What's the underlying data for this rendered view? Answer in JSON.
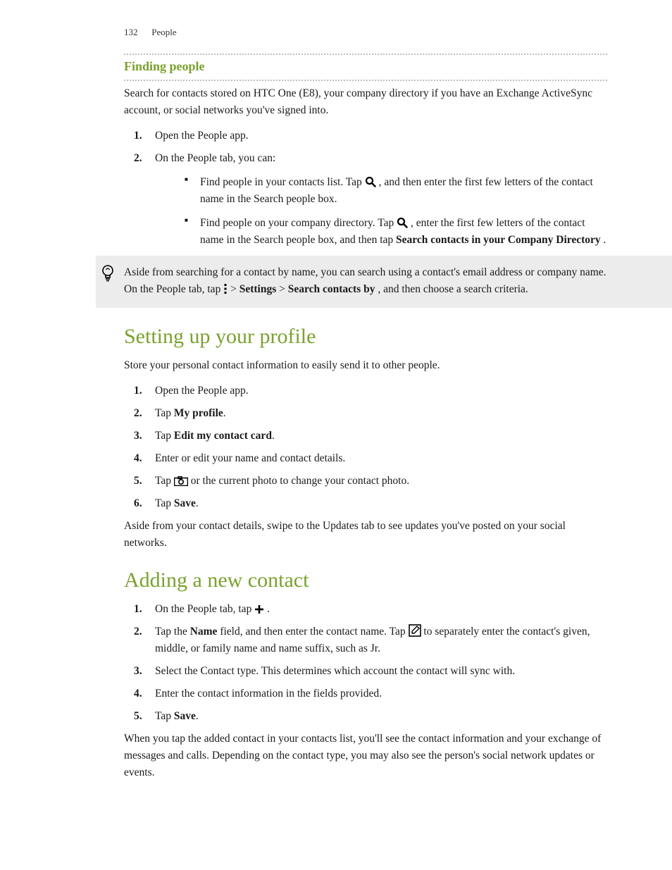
{
  "header": {
    "page_number": "132",
    "section": "People"
  },
  "sec_finding": {
    "title": "Finding people",
    "intro": "Search for contacts stored on HTC One (E8), your company directory if you have an Exchange ActiveSync account, or social networks you've signed into.",
    "step1": "Open the People app.",
    "step2": "On the People tab, you can:",
    "b1a": "Find people in your contacts list. Tap ",
    "b1b": " , and then enter the first few letters of the contact name in the Search people box.",
    "b2a": "Find people on your company directory. Tap ",
    "b2b": " , enter the first few letters of the contact name in the Search people box, and then tap ",
    "b2c": "Search contacts in your Company Directory",
    "b2d": "."
  },
  "tip": {
    "t1": "Aside from searching for a contact by name, you can search using a contact's email address or company name. On the People tab, tap ",
    "t2": " > ",
    "settings": "Settings",
    "t3": " > ",
    "scb": "Search contacts by",
    "t4": ", and then choose a search criteria."
  },
  "sec_profile": {
    "title": "Setting up your profile",
    "intro": "Store your personal contact information to easily send it to other people.",
    "s1": "Open the People app.",
    "s2a": "Tap ",
    "s2b": "My profile",
    "s2c": ".",
    "s3a": "Tap ",
    "s3b": "Edit my contact card",
    "s3c": ".",
    "s4": "Enter or edit your name and contact details.",
    "s5a": "Tap ",
    "s5b": " or the current photo to change your contact photo.",
    "s6a": "Tap ",
    "s6b": "Save",
    "s6c": ".",
    "after": "Aside from your contact details, swipe to the Updates tab to see updates you've posted on your social networks."
  },
  "sec_add": {
    "title": "Adding a new contact",
    "s1a": "On the People tab, tap ",
    "s1b": ".",
    "s2a": "Tap the ",
    "s2b": "Name",
    "s2c": " field, and then enter the contact name. Tap ",
    "s2d": " to separately enter the contact's given, middle, or family name and name suffix, such as Jr.",
    "s3": "Select the Contact type. This determines which account the contact will sync with.",
    "s4": "Enter the contact information in the fields provided.",
    "s5a": "Tap ",
    "s5b": "Save",
    "s5c": ".",
    "after": "When you tap the added contact in your contacts list, you'll see the contact information and your exchange of messages and calls. Depending on the contact type, you may also see the person's social network updates or events."
  },
  "markers": {
    "m1": "1.",
    "m2": "2.",
    "m3": "3.",
    "m4": "4.",
    "m5": "5.",
    "m6": "6."
  }
}
